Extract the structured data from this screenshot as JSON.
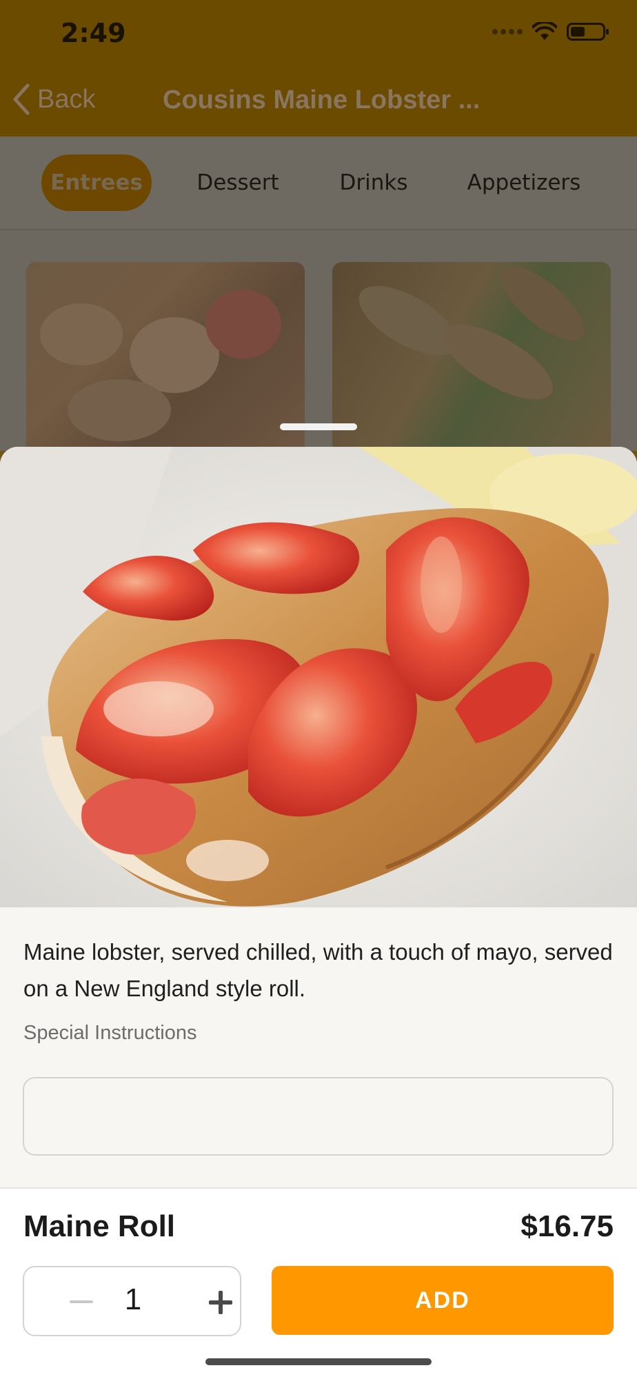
{
  "status_bar": {
    "time": "2:49",
    "icons": [
      "signal-icon",
      "wifi-icon",
      "battery-icon"
    ]
  },
  "nav": {
    "back_label": "Back",
    "title": "Cousins Maine Lobster ..."
  },
  "tabs": [
    {
      "label": "Entrees",
      "active": true
    },
    {
      "label": "Dessert",
      "active": false
    },
    {
      "label": "Drinks",
      "active": false
    },
    {
      "label": "Appetizers",
      "active": false
    }
  ],
  "item": {
    "description": "Maine lobster, served chilled, with a touch of mayo, served on a New England style roll.",
    "special_instructions_label": "Special Instructions",
    "special_instructions_value": "",
    "name": "Maine Roll",
    "price": "$16.75",
    "quantity": "1",
    "add_label": "ADD"
  },
  "colors": {
    "accent": "#FF9800",
    "nav_dimmed": "#6B4B00",
    "sheet_bg": "#F7F6F3"
  }
}
